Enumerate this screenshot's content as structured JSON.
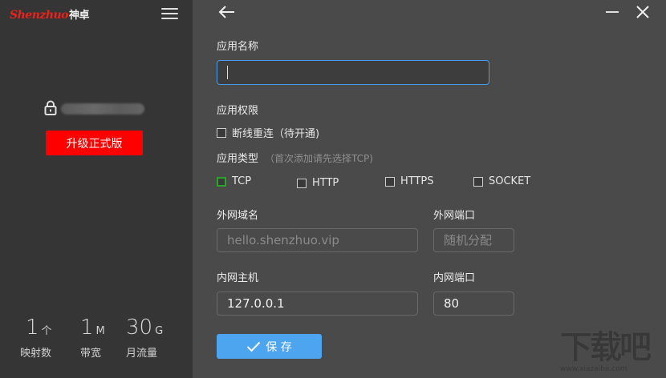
{
  "sidebar": {
    "logo_latin": "Shenzhuo",
    "logo_cn": "神卓",
    "upgrade_label": "升级正式版",
    "stats": [
      {
        "value": "1",
        "unit": "个",
        "label": "映射数"
      },
      {
        "value": "1",
        "unit": "M",
        "label": "带宽"
      },
      {
        "value": "30",
        "unit": "G",
        "label": "月流量"
      }
    ]
  },
  "form": {
    "app_name_label": "应用名称",
    "app_name_value": "",
    "permission_label": "应用权限",
    "reconnect_label": "断线重连（待开通)",
    "type_label": "应用类型",
    "type_hint": "（首次添加请先选择TCP)",
    "types": [
      {
        "label": "TCP",
        "checked": true
      },
      {
        "label": "HTTP",
        "checked": false
      },
      {
        "label": "HTTPS",
        "checked": false
      },
      {
        "label": "SOCKET",
        "checked": false
      }
    ],
    "ext_domain_label": "外网域名",
    "ext_domain_placeholder": "hello.shenzhuo.vip",
    "ext_port_label": "外网端口",
    "ext_port_placeholder": "随机分配",
    "int_host_label": "内网主机",
    "int_host_value": "127.0.0.1",
    "int_port_label": "内网端口",
    "int_port_value": "80",
    "save_label": "保 存"
  },
  "watermark": {
    "big": "下载吧",
    "small": "www.xiazaiba.com"
  },
  "colors": {
    "accent": "#4ea5ef",
    "upgrade": "#ff0000",
    "checked": "#2aa52a"
  }
}
